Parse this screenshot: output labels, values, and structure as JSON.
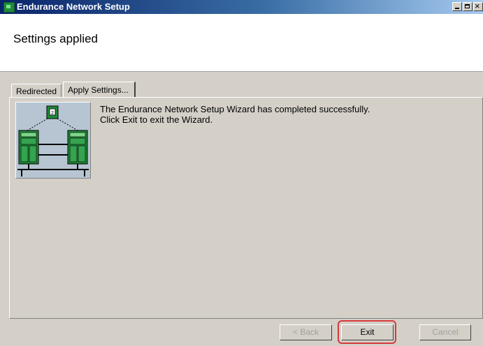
{
  "window": {
    "title": "Endurance Network Setup",
    "icon": "network-setup-icon"
  },
  "header": {
    "title": "Settings applied"
  },
  "tabs": [
    {
      "label": "Redirected",
      "active": false
    },
    {
      "label": "Apply Settings...",
      "active": true
    }
  ],
  "content": {
    "line1": "The Endurance Network Setup Wizard has completed successfully.",
    "line2": "Click Exit to exit the Wizard.",
    "illustration_badge": "2"
  },
  "buttons": {
    "back": {
      "label": "< Back",
      "enabled": false
    },
    "exit": {
      "label": "Exit",
      "enabled": true,
      "highlighted": true
    },
    "cancel": {
      "label": "Cancel",
      "enabled": false
    }
  },
  "colors": {
    "titlebar": "#0a246a",
    "face": "#d4d0c8",
    "server_green": "#1f8a3a",
    "highlight_red": "#d63a3a"
  }
}
